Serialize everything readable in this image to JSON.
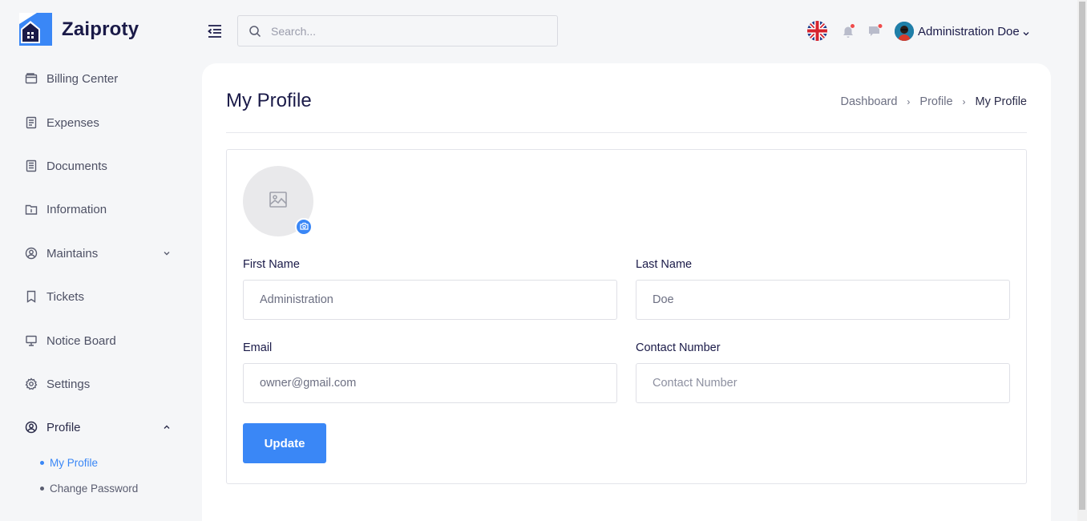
{
  "brand": {
    "name": "Zaiproty"
  },
  "sidebar": {
    "items": [
      {
        "label": "Billing Center",
        "icon": "wallet-icon"
      },
      {
        "label": "Expenses",
        "icon": "receipt-icon"
      },
      {
        "label": "Documents",
        "icon": "document-icon"
      },
      {
        "label": "Information",
        "icon": "info-folder-icon"
      },
      {
        "label": "Maintains",
        "icon": "user-circle-icon",
        "expandable": true,
        "expanded": false
      },
      {
        "label": "Tickets",
        "icon": "bookmark-icon"
      },
      {
        "label": "Notice Board",
        "icon": "monitor-icon"
      },
      {
        "label": "Settings",
        "icon": "gear-icon"
      },
      {
        "label": "Profile",
        "icon": "user-circle-icon",
        "expandable": true,
        "expanded": true
      }
    ],
    "profile_sub": [
      {
        "label": "My Profile",
        "active": true
      },
      {
        "label": "Change Password",
        "active": false
      }
    ]
  },
  "header": {
    "search_placeholder": "Search...",
    "language": "English (UK)",
    "user_name": "Administration Doe"
  },
  "page": {
    "title": "My Profile",
    "breadcrumb": [
      "Dashboard",
      "Profile",
      "My Profile"
    ]
  },
  "form": {
    "first_name_label": "First Name",
    "first_name_value": "Administration",
    "last_name_label": "Last Name",
    "last_name_value": "Doe",
    "email_label": "Email",
    "email_value": "owner@gmail.com",
    "contact_label": "Contact Number",
    "contact_placeholder": "Contact Number",
    "contact_value": "",
    "submit_label": "Update"
  },
  "colors": {
    "accent": "#3a87f6",
    "brand_dark": "#1a1a48",
    "notification_dot": "#f04b4b"
  }
}
